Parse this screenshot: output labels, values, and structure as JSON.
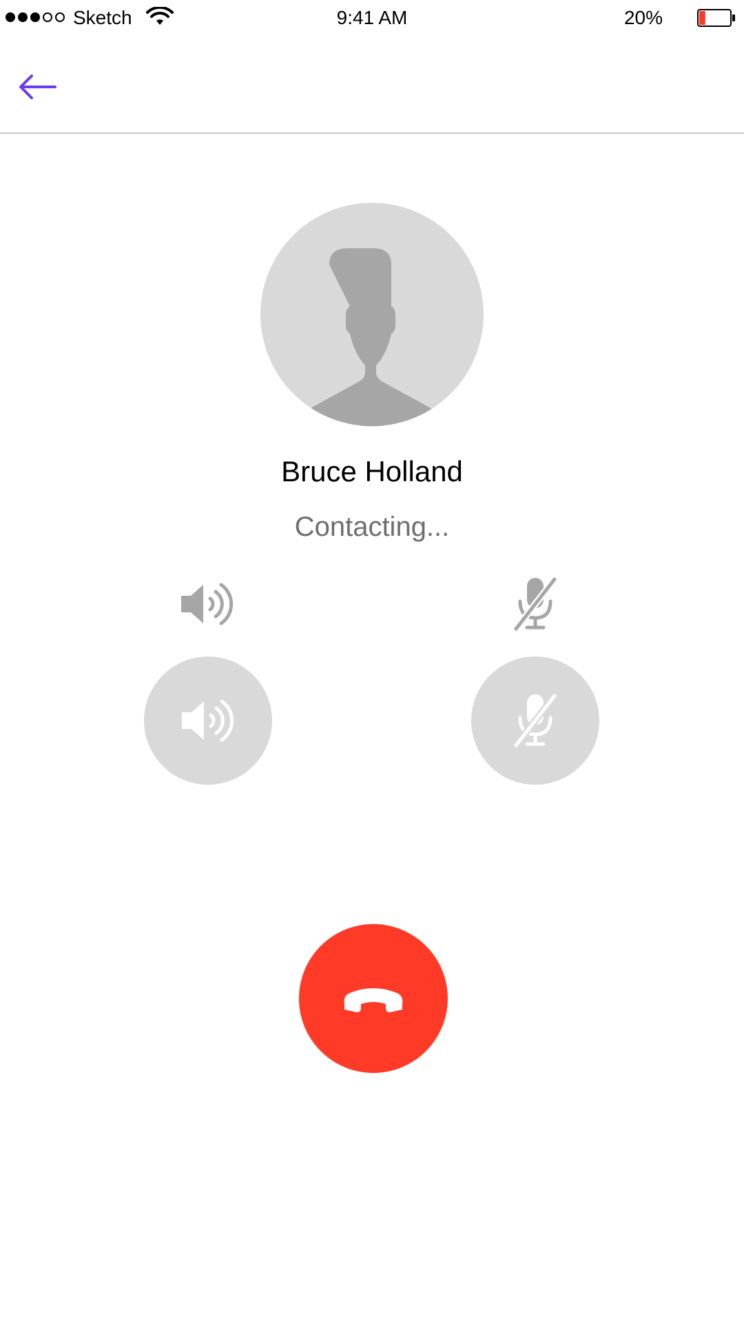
{
  "status_bar": {
    "signal_bars": 3,
    "signal_total": 5,
    "carrier": "Sketch",
    "wifi_icon": "wifi-icon",
    "time": "9:41 AM",
    "battery_percent": "20%",
    "battery_level": 0.2,
    "battery_color": "#ff3b28"
  },
  "nav": {
    "back_icon": "arrow-left-icon",
    "accent_color": "#6a3bef"
  },
  "contact": {
    "avatar_icon": "person-placeholder-icon",
    "name": "Bruce Holland",
    "status": "Contacting..."
  },
  "controls": {
    "speaker_icon": "speaker-icon",
    "mute_icon": "microphone-muted-icon",
    "end_call_icon": "phone-hangup-icon",
    "end_call_color": "#ff3b28"
  }
}
